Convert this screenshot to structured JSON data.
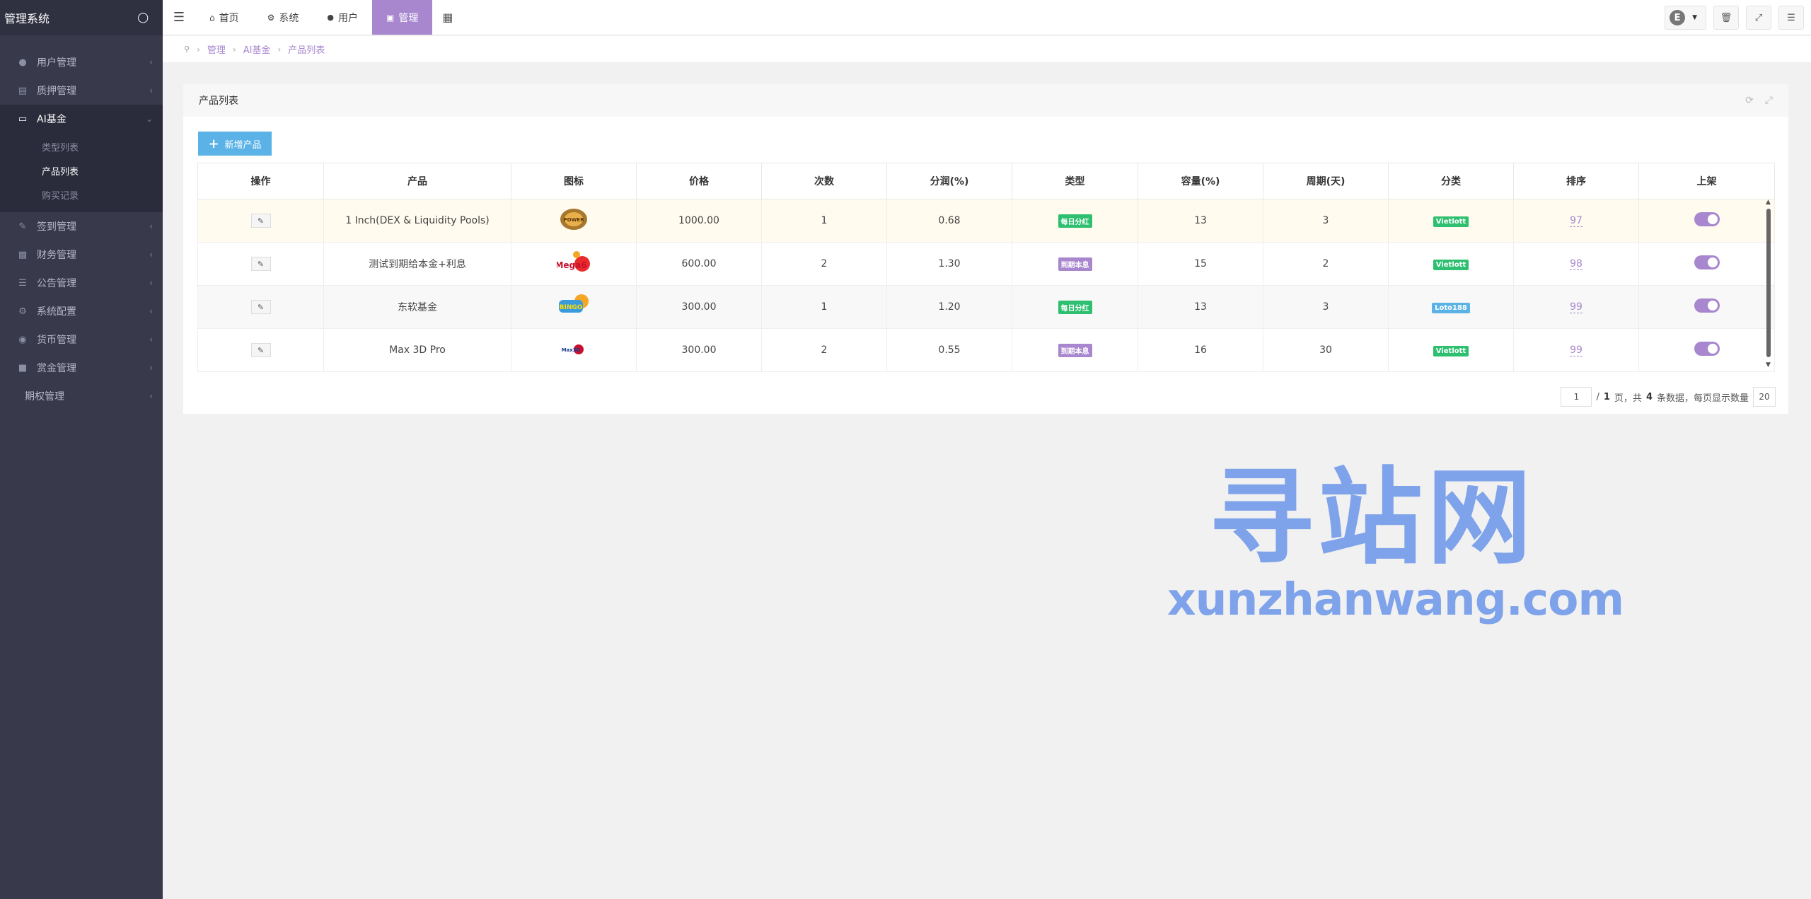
{
  "app": {
    "title": "管理系统"
  },
  "sidebar": {
    "items": [
      {
        "label": "用户管理",
        "icon": "user-icon"
      },
      {
        "label": "质押管理",
        "icon": "table-icon"
      },
      {
        "label": "AI基金",
        "icon": "desktop-icon"
      },
      {
        "label": "签到管理",
        "icon": "edit-icon"
      },
      {
        "label": "财务管理",
        "icon": "money-icon"
      },
      {
        "label": "公告管理",
        "icon": "list-icon"
      },
      {
        "label": "系统配置",
        "icon": "cogs-icon"
      },
      {
        "label": "货币管理",
        "icon": "globe-icon"
      },
      {
        "label": "赏金管理",
        "icon": "bank-icon"
      },
      {
        "label": "期权管理",
        "icon": ""
      }
    ],
    "subitems": [
      "类型列表",
      "产品列表",
      "购买记录"
    ]
  },
  "topbar": {
    "tabs": [
      "首页",
      "系统",
      "用户",
      "管理"
    ],
    "avatar_letter": "E"
  },
  "breadcrumb": [
    "管理",
    "AI基金",
    "产品列表"
  ],
  "panel": {
    "title": "产品列表",
    "add_button": "新增产品"
  },
  "table": {
    "headers": [
      "操作",
      "产品",
      "图标",
      "价格",
      "次数",
      "分润(%)",
      "类型",
      "容量(%)",
      "周期(天)",
      "分类",
      "排序",
      "上架"
    ],
    "rows": [
      {
        "product": "1 Inch(DEX & Liquidity Pools)",
        "icon_text": "POWER",
        "price": "1000.00",
        "times": "1",
        "profit": "0.68",
        "type": "每日分红",
        "capacity": "13",
        "cycle": "3",
        "category": "Vietlott",
        "sort": "97"
      },
      {
        "product": "测试到期给本金+利息",
        "icon_text": "Mega6",
        "price": "600.00",
        "times": "2",
        "profit": "1.30",
        "type": "到期本息",
        "capacity": "15",
        "cycle": "2",
        "category": "Vietlott",
        "sort": "98"
      },
      {
        "product": "东软基金",
        "icon_text": "BINGO",
        "price": "300.00",
        "times": "1",
        "profit": "1.20",
        "type": "每日分红",
        "capacity": "13",
        "cycle": "3",
        "category": "Loto188",
        "sort": "99"
      },
      {
        "product": "Max 3D Pro",
        "icon_text": "Max3D",
        "price": "300.00",
        "times": "2",
        "profit": "0.55",
        "type": "到期本息",
        "capacity": "16",
        "cycle": "30",
        "category": "Vietlott",
        "sort": "99"
      }
    ]
  },
  "pager": {
    "page": "1",
    "sep": "/",
    "total_pages": "1",
    "text_page": "页，共",
    "total": "4",
    "text_records": "条数据，每页显示数量",
    "per_page": "20"
  },
  "watermark": {
    "big": "寻站网",
    "small": "xunzhanwang.com"
  }
}
